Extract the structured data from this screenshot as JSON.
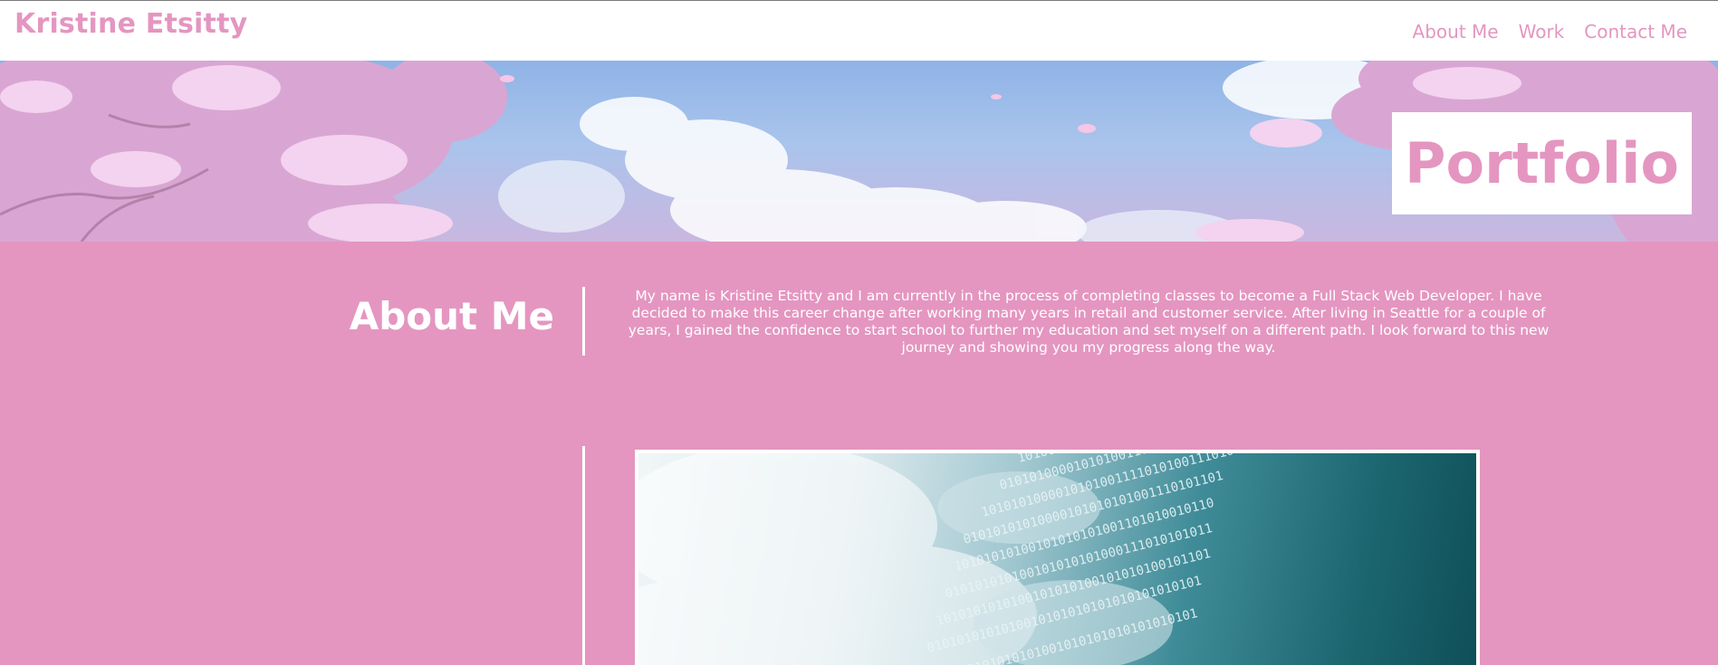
{
  "header": {
    "site_title": "Kristine Etsitty",
    "nav": [
      {
        "label": "About Me"
      },
      {
        "label": "Work"
      },
      {
        "label": "Contact Me"
      }
    ]
  },
  "hero": {
    "title": "Portfolio",
    "background": "cherry-blossom-sky-image"
  },
  "about": {
    "heading": "About Me",
    "body": "My name is Kristine Etsitty and I am currently in the process of completing classes to become a Full Stack Web Developer. I have decided to make this career change after working many years in retail and customer service. After living in Seattle for a couple of years, I gained the confidence to start school to further my education and set myself on a different path. I look forward to this new journey and showing you my progress along the way."
  },
  "work": {
    "image": "binary-code-wave-image"
  },
  "colors": {
    "accent_pink": "#e496c0",
    "white": "#ffffff"
  }
}
